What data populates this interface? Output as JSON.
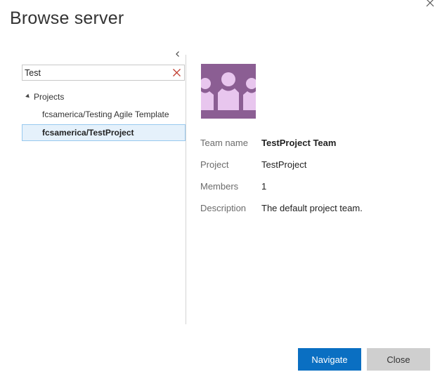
{
  "dialog": {
    "title": "Browse server"
  },
  "search": {
    "value": "Test",
    "placeholder": ""
  },
  "tree": {
    "root_label": "Projects",
    "items": [
      {
        "label": "fcsamerica/Testing Agile Template",
        "selected": false
      },
      {
        "label": "fcsamerica/TestProject",
        "selected": true
      }
    ]
  },
  "details": {
    "team_name_label": "Team name",
    "team_name_value": "TestProject Team",
    "project_label": "Project",
    "project_value": "TestProject",
    "members_label": "Members",
    "members_value": "1",
    "description_label": "Description",
    "description_value": "The default project team."
  },
  "buttons": {
    "navigate_label": "Navigate",
    "close_label": "Close"
  },
  "colors": {
    "primary": "#0a6fc2",
    "avatar_bg": "#8b5e93",
    "avatar_fg": "#e8c6ee",
    "selection_bg": "#e5f1fb",
    "selection_border": "#99c9ef"
  },
  "icons": {
    "close": "close-icon",
    "collapse": "chevron-left-icon",
    "clear": "clear-search-icon",
    "expand": "triangle-expanded-icon",
    "team": "team-avatar-icon"
  }
}
